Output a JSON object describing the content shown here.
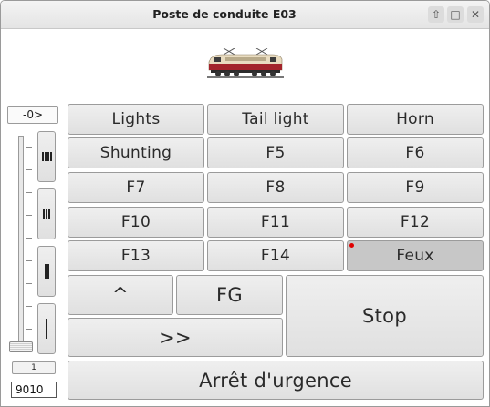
{
  "window": {
    "title": "Poste de conduite E03"
  },
  "controls": {
    "minimize_icon": "upload-icon",
    "maximize_icon": "maximize-icon",
    "close_icon": "close-icon"
  },
  "direction_display": "-0>",
  "speed": {
    "level": 0,
    "notches": [
      "IIII",
      "III",
      "II",
      "I"
    ]
  },
  "speed_step_value": "1",
  "address_input": "9010",
  "functions": [
    {
      "label": "Lights",
      "active": false
    },
    {
      "label": "Tail light",
      "active": false
    },
    {
      "label": "Horn",
      "active": false
    },
    {
      "label": "Shunting",
      "active": false
    },
    {
      "label": "F5",
      "active": false
    },
    {
      "label": "F6",
      "active": false
    },
    {
      "label": "F7",
      "active": false
    },
    {
      "label": "F8",
      "active": false
    },
    {
      "label": "F9",
      "active": false
    },
    {
      "label": "F10",
      "active": false
    },
    {
      "label": "F11",
      "active": false
    },
    {
      "label": "F12",
      "active": false
    },
    {
      "label": "F13",
      "active": false
    },
    {
      "label": "F14",
      "active": false
    },
    {
      "label": "Feux",
      "active": true
    }
  ],
  "drive": {
    "up_label": "^",
    "fg_label": "FG",
    "stop_label": "Stop",
    "forward_label": ">>",
    "emergency_label": "Arrêt d'urgence"
  },
  "colors": {
    "led_active": "#e00000",
    "pressed": "#c7c7c7"
  }
}
